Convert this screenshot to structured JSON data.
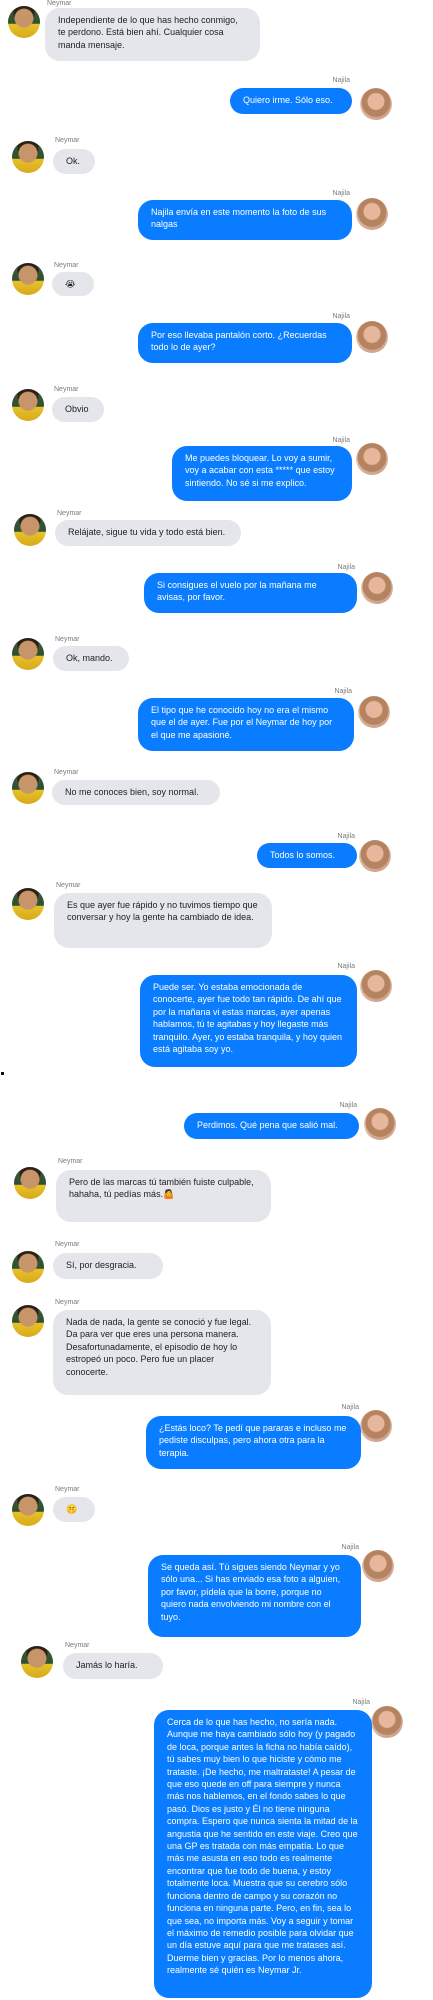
{
  "conversation": {
    "messages": [
      {
        "sender": "Neymar",
        "dir": "in",
        "text": "Independiente de lo que has hecho conmigo, te perdono. Está bien ahí. Cualquier cosa manda mensaje."
      },
      {
        "sender": "Najila",
        "dir": "out",
        "text": "Quiero irme. Sólo eso."
      },
      {
        "sender": "Neymar",
        "dir": "in",
        "text": "Ok."
      },
      {
        "sender": "Najila",
        "dir": "out",
        "text": "Najila envía en este momento la foto de sus nalgas"
      },
      {
        "sender": "Neymar",
        "dir": "in",
        "text": "😭"
      },
      {
        "sender": "Najila",
        "dir": "out",
        "text": "Por eso llevaba pantalón corto. ¿Recuerdas todo lo de ayer?"
      },
      {
        "sender": "Neymar",
        "dir": "in",
        "text": "Obvio"
      },
      {
        "sender": "Najila",
        "dir": "out",
        "text": "Me puedes bloquear. Lo voy a sumir, voy a acabar con esta ***** que estoy sintiendo. No sé si me explico."
      },
      {
        "sender": "Neymar",
        "dir": "in",
        "text": "Relájate, sigue tu vida y todo está bien."
      },
      {
        "sender": "Najila",
        "dir": "out",
        "text": "Si consigues el vuelo por la mañana me avisas, por favor."
      },
      {
        "sender": "Neymar",
        "dir": "in",
        "text": "Ok, mando."
      },
      {
        "sender": "Najila",
        "dir": "out",
        "text": "El tipo que he conocido hoy no era el mismo que el de ayer. Fue por el Neymar de hoy por el que me apasioné."
      },
      {
        "sender": "Neymar",
        "dir": "in",
        "text": "No me conoces bien, soy normal."
      },
      {
        "sender": "Najila",
        "dir": "out",
        "text": "Todos lo somos."
      },
      {
        "sender": "Neymar",
        "dir": "in",
        "text": "Es que ayer fue rápido y no tuvimos tiempo que conversar y hoy la gente ha cambiado de idea."
      },
      {
        "sender": "Najila",
        "dir": "out",
        "text": "Puede ser. Yo estaba emocionada de conocerte, ayer fue todo tan rápido. De ahí que por la mañana vi estas marcas, ayer apenas hablamos, tú te agitabas y hoy llegaste más tranquilo. Ayer, yo estaba tranquila, y hoy quien está agitaba soy yo."
      },
      {
        "sender": "Najila",
        "dir": "out",
        "text": "Perdimos. Qué pena que salió mal."
      },
      {
        "sender": "Neymar",
        "dir": "in",
        "text": "Pero de las marcas tú también fuiste culpable, hahaha, tú pedías más.🤷"
      },
      {
        "sender": "Neymar",
        "dir": "in",
        "text": "Sí, por desgracia."
      },
      {
        "sender": "Neymar",
        "dir": "in",
        "text": "Nada de nada, la gente se conoció y fue legal. Da para ver que eres una persona manera. Desafortunadamente, el episodio de hoy lo estropeó un poco. Pero fue un placer conocerte."
      },
      {
        "sender": "Najila",
        "dir": "out",
        "text": "¿Estás loco? Te pedí que pararas e incluso me pediste disculpas, pero ahora otra para la terapia."
      },
      {
        "sender": "Neymar",
        "dir": "in",
        "text": "🤫"
      },
      {
        "sender": "Najila",
        "dir": "out",
        "text": "Se queda así. Tú sigues siendo Neymar y yo sólo una... Si has enviado esa foto a alguien, por favor, pídela que la borre, porque no quiero nada envolviendo mi nombre con el tuyo."
      },
      {
        "sender": "Neymar",
        "dir": "in",
        "text": "Jamás lo haría."
      },
      {
        "sender": "Najila",
        "dir": "out",
        "text": "Cerca de lo que has hecho, no sería nada. Aunque me haya cambiado sólo hoy (y pagado de loca, porque antes la ficha no había caído), tú sabes muy bien lo que hiciste y cómo me trataste. ¡De hecho, me maltrataste! A pesar de que eso quede en off para siempre y nunca más nos hablemos, en el fondo sabes lo que pasó. Dios es justo y Él no tiene ninguna compra. Espero que nunca sienta la mitad de la angustia que he sentido en este viaje. Creo que una GP es tratada con más empatía. Lo que más me asusta en eso todo es realmente encontrar que fue todo de buena, y estoy totalmente loca. Muestra que su cerebro sólo funciona dentro de campo y su corazón no funciona en ninguna parte. Pero, en fin, sea lo que sea, no importa más. Voy a seguir y tomar el máximo de remedio posible para olvidar que un día estuve aquí para que me tratases así. Duerme bien y gracias. Por lo menos ahora, realmente sé quién es Neymar Jr."
      }
    ]
  }
}
